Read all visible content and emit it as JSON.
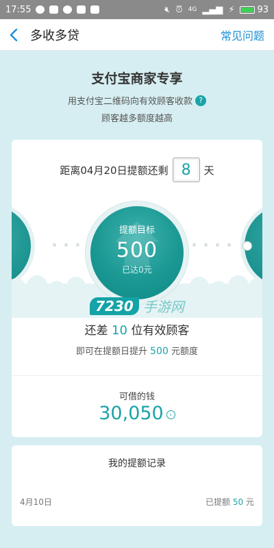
{
  "status_bar": {
    "time": "17:55",
    "network": "4G",
    "battery": "93"
  },
  "nav": {
    "title": "多收多贷",
    "right_link": "常见问题"
  },
  "header": {
    "title": "支付宝商家专享",
    "subtitle": "用支付宝二维码向有效顾客收款",
    "subtitle2": "顾客越多额度越高"
  },
  "countdown": {
    "prefix": "距离04月20日提额还剩",
    "days": "8",
    "suffix": "天"
  },
  "target": {
    "label": "提额目标",
    "amount": "500",
    "reached": "已达0元"
  },
  "watermark": {
    "num": "7230",
    "txt": "手游网"
  },
  "progress": {
    "need_prefix": "还差",
    "need_count": "10",
    "need_suffix": "位有效顾客",
    "boost_prefix": "即可在提额日提升",
    "boost_amount": "500",
    "boost_suffix": "元额度"
  },
  "borrow": {
    "label": "可借的钱",
    "amount": "30,050"
  },
  "records": {
    "title": "我的提额记录",
    "items": [
      {
        "date": "4月10日",
        "prefix": "已提额",
        "amount": "50",
        "unit": "元"
      }
    ]
  },
  "colors": {
    "accent": "#1aa3a8",
    "link": "#1a8fd6",
    "background": "#d6eef1"
  }
}
